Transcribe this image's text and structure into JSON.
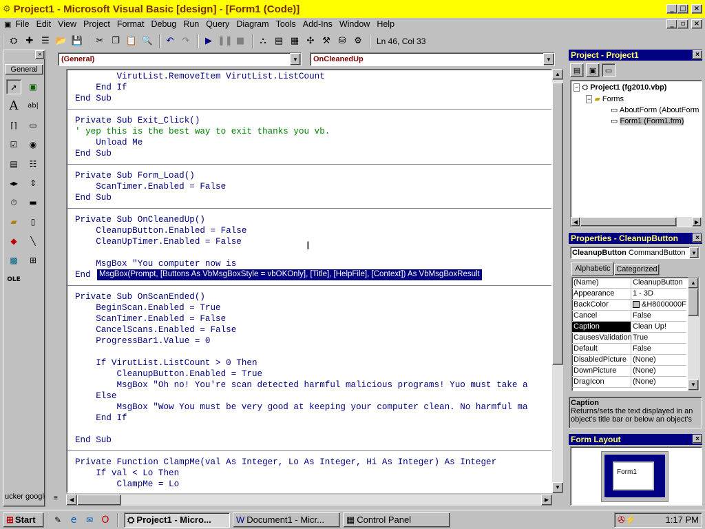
{
  "window": {
    "title": "Project1 - Microsoft Visual Basic [design] - [Form1 (Code)]"
  },
  "menu": [
    "File",
    "Edit",
    "View",
    "Project",
    "Format",
    "Debug",
    "Run",
    "Query",
    "Diagram",
    "Tools",
    "Add-Ins",
    "Window",
    "Help"
  ],
  "toolbar": {
    "status": "Ln 46, Col 33"
  },
  "toolbox": {
    "tab": "General",
    "bottom_text": "ucker google"
  },
  "code": {
    "object_combo": "(General)",
    "proc_combo": "OnCleanedUp",
    "lines": [
      {
        "t": "        VirutList.RemoveItem VirutList.ListCount",
        "c": ""
      },
      {
        "t": "    End If",
        "c": ""
      },
      {
        "t": "End Sub",
        "c": ""
      },
      {
        "t": "",
        "c": ""
      },
      {
        "t": "Private Sub Exit_Click()",
        "c": ""
      },
      {
        "t": "' yep this is the best way to exit thanks you vb.",
        "c": "green"
      },
      {
        "t": "    Unload Me",
        "c": ""
      },
      {
        "t": "End Sub",
        "c": ""
      },
      {
        "t": "",
        "c": ""
      },
      {
        "t": "Private Sub Form_Load()",
        "c": ""
      },
      {
        "t": "    ScanTimer.Enabled = False",
        "c": ""
      },
      {
        "t": "End Sub",
        "c": ""
      },
      {
        "t": "",
        "c": ""
      },
      {
        "t": "Private Sub OnCleanedUp()",
        "c": ""
      },
      {
        "t": "    CleanupButton.Enabled = False",
        "c": ""
      },
      {
        "t": "    CleanUpTimer.Enabled = False",
        "c": ""
      },
      {
        "t": "",
        "c": ""
      },
      {
        "t": "    MsgBox \"You computer now is ",
        "c": ""
      },
      {
        "t": "End",
        "c": ""
      },
      {
        "t": "",
        "c": ""
      },
      {
        "t": "Private Sub OnScanEnded()",
        "c": ""
      },
      {
        "t": "    BeginScan.Enabled = True",
        "c": ""
      },
      {
        "t": "    ScanTimer.Enabled = False",
        "c": ""
      },
      {
        "t": "    CancelScans.Enabled = False",
        "c": ""
      },
      {
        "t": "    ProgressBar1.Value = 0",
        "c": ""
      },
      {
        "t": "",
        "c": ""
      },
      {
        "t": "    If VirutList.ListCount > 0 Then",
        "c": ""
      },
      {
        "t": "        CleanupButton.Enabled = True",
        "c": ""
      },
      {
        "t": "        MsgBox \"Oh no! You're scan detected harmful malicious programs! Yuo must take a",
        "c": ""
      },
      {
        "t": "    Else",
        "c": ""
      },
      {
        "t": "        MsgBox \"Wow You must be very good at keeping your computer clean. No harmful ma",
        "c": ""
      },
      {
        "t": "    End If",
        "c": ""
      },
      {
        "t": "",
        "c": ""
      },
      {
        "t": "End Sub",
        "c": ""
      },
      {
        "t": "",
        "c": ""
      },
      {
        "t": "Private Function ClampMe(val As Integer, Lo As Integer, Hi As Integer) As Integer",
        "c": ""
      },
      {
        "t": "    If val < Lo Then",
        "c": ""
      },
      {
        "t": "        ClampMe = Lo",
        "c": ""
      }
    ],
    "tooltip": "MsgBox(Prompt, [Buttons As VbMsgBoxStyle = vbOKOnly], [Title], [HelpFile], [Context]) As VbMsgBoxResult"
  },
  "project": {
    "title": "Project - Project1",
    "root": "Project1 (fg2010.vbp)",
    "folder": "Forms",
    "items": [
      "AboutForm (AboutForm",
      "Form1 (Form1.frm)"
    ]
  },
  "properties": {
    "title": "Properties - CleanupButton",
    "object": "CleanupButton",
    "object_type": "CommandButton",
    "tabs": [
      "Alphabetic",
      "Categorized"
    ],
    "rows": [
      {
        "name": "(Name)",
        "value": "CleanupButton"
      },
      {
        "name": "Appearance",
        "value": "1 - 3D"
      },
      {
        "name": "BackColor",
        "value": "&H8000000F"
      },
      {
        "name": "Cancel",
        "value": "False"
      },
      {
        "name": "Caption",
        "value": "Clean Up!"
      },
      {
        "name": "CausesValidation",
        "value": "True"
      },
      {
        "name": "Default",
        "value": "False"
      },
      {
        "name": "DisabledPicture",
        "value": "(None)"
      },
      {
        "name": "DownPicture",
        "value": "(None)"
      },
      {
        "name": "DragIcon",
        "value": "(None)"
      }
    ],
    "desc_title": "Caption",
    "desc_text": "Returns/sets the text displayed in an object's title bar or below an object's"
  },
  "form_layout": {
    "title": "Form Layout",
    "form_label": "Form1"
  },
  "taskbar": {
    "start": "Start",
    "tasks": [
      "Project1 - Micro...",
      "Document1 - Micr...",
      "Control Panel"
    ],
    "clock": "1:17 PM"
  }
}
